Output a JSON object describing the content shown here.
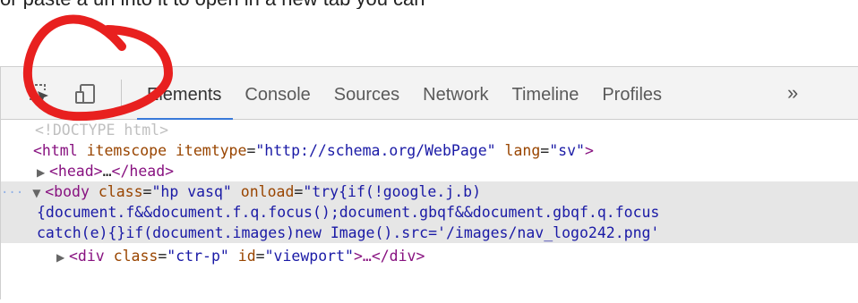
{
  "top_text": "or paste a url into it to open in a new tab you can",
  "toolbar": {
    "inspect_icon": "inspect-element-icon",
    "device_icon": "device-mode-icon",
    "tabs": [
      {
        "label": "Elements",
        "active": true
      },
      {
        "label": "Console",
        "active": false
      },
      {
        "label": "Sources",
        "active": false
      },
      {
        "label": "Network",
        "active": false
      },
      {
        "label": "Timeline",
        "active": false
      },
      {
        "label": "Profiles",
        "active": false
      }
    ],
    "more_label": "»"
  },
  "dom": {
    "doctype": "<!DOCTYPE html>",
    "html_line": {
      "tag_open": "<html",
      "attr1": "itemscope",
      "attr2": "itemtype",
      "val2": "\"http://schema.org/WebPage\"",
      "attr3": "lang",
      "val3": "\"sv\"",
      "tag_close": ">"
    },
    "head_line": {
      "open": "<head>",
      "ellipsis": "…",
      "close": "</head>"
    },
    "body_line": {
      "tag_open": "<body",
      "attr1": "class",
      "val1": "\"hp vasq\"",
      "attr2": "onload",
      "val2_part1": "\"try{if(!google.j.b)",
      "val2_part2": "{document.f&&document.f.q.focus();document.gbqf&&document.gbqf.q.focus",
      "val2_part3": "catch(e){}if(document.images)new Image().src='/images/nav_logo242.png'"
    },
    "div_line": {
      "tag_open": "<div",
      "attr1": "class",
      "val1": "\"ctr-p\"",
      "attr2": "id",
      "val2": "\"viewport\"",
      "middle": ">…",
      "tag_close": "</div>"
    }
  },
  "annotation": {
    "shape": "circle",
    "color": "#e8201f"
  }
}
